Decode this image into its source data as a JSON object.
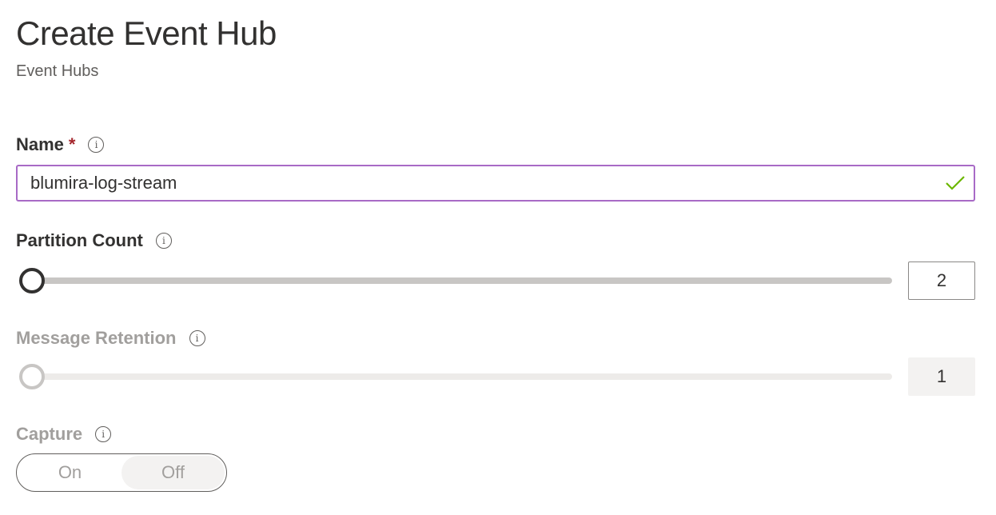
{
  "header": {
    "title": "Create Event Hub",
    "subtitle": "Event Hubs"
  },
  "form": {
    "name": {
      "label": "Name",
      "required_marker": "*",
      "value": "blumira-log-stream",
      "valid": true
    },
    "partition_count": {
      "label": "Partition Count",
      "value": "2",
      "slider_fraction": 0.0,
      "disabled": false
    },
    "message_retention": {
      "label": "Message Retention",
      "value": "1",
      "slider_fraction": 0.0,
      "disabled": true
    },
    "capture": {
      "label": "Capture",
      "options": [
        "On",
        "Off"
      ],
      "selected": "Off",
      "disabled": true
    }
  },
  "icons": {
    "info": "i",
    "valid": "checkmark-icon"
  },
  "colors": {
    "focus_border": "#a86ac6",
    "valid_check": "#6bb700",
    "required": "#a4262c",
    "text_primary": "#323130",
    "text_disabled": "#a19f9d"
  }
}
